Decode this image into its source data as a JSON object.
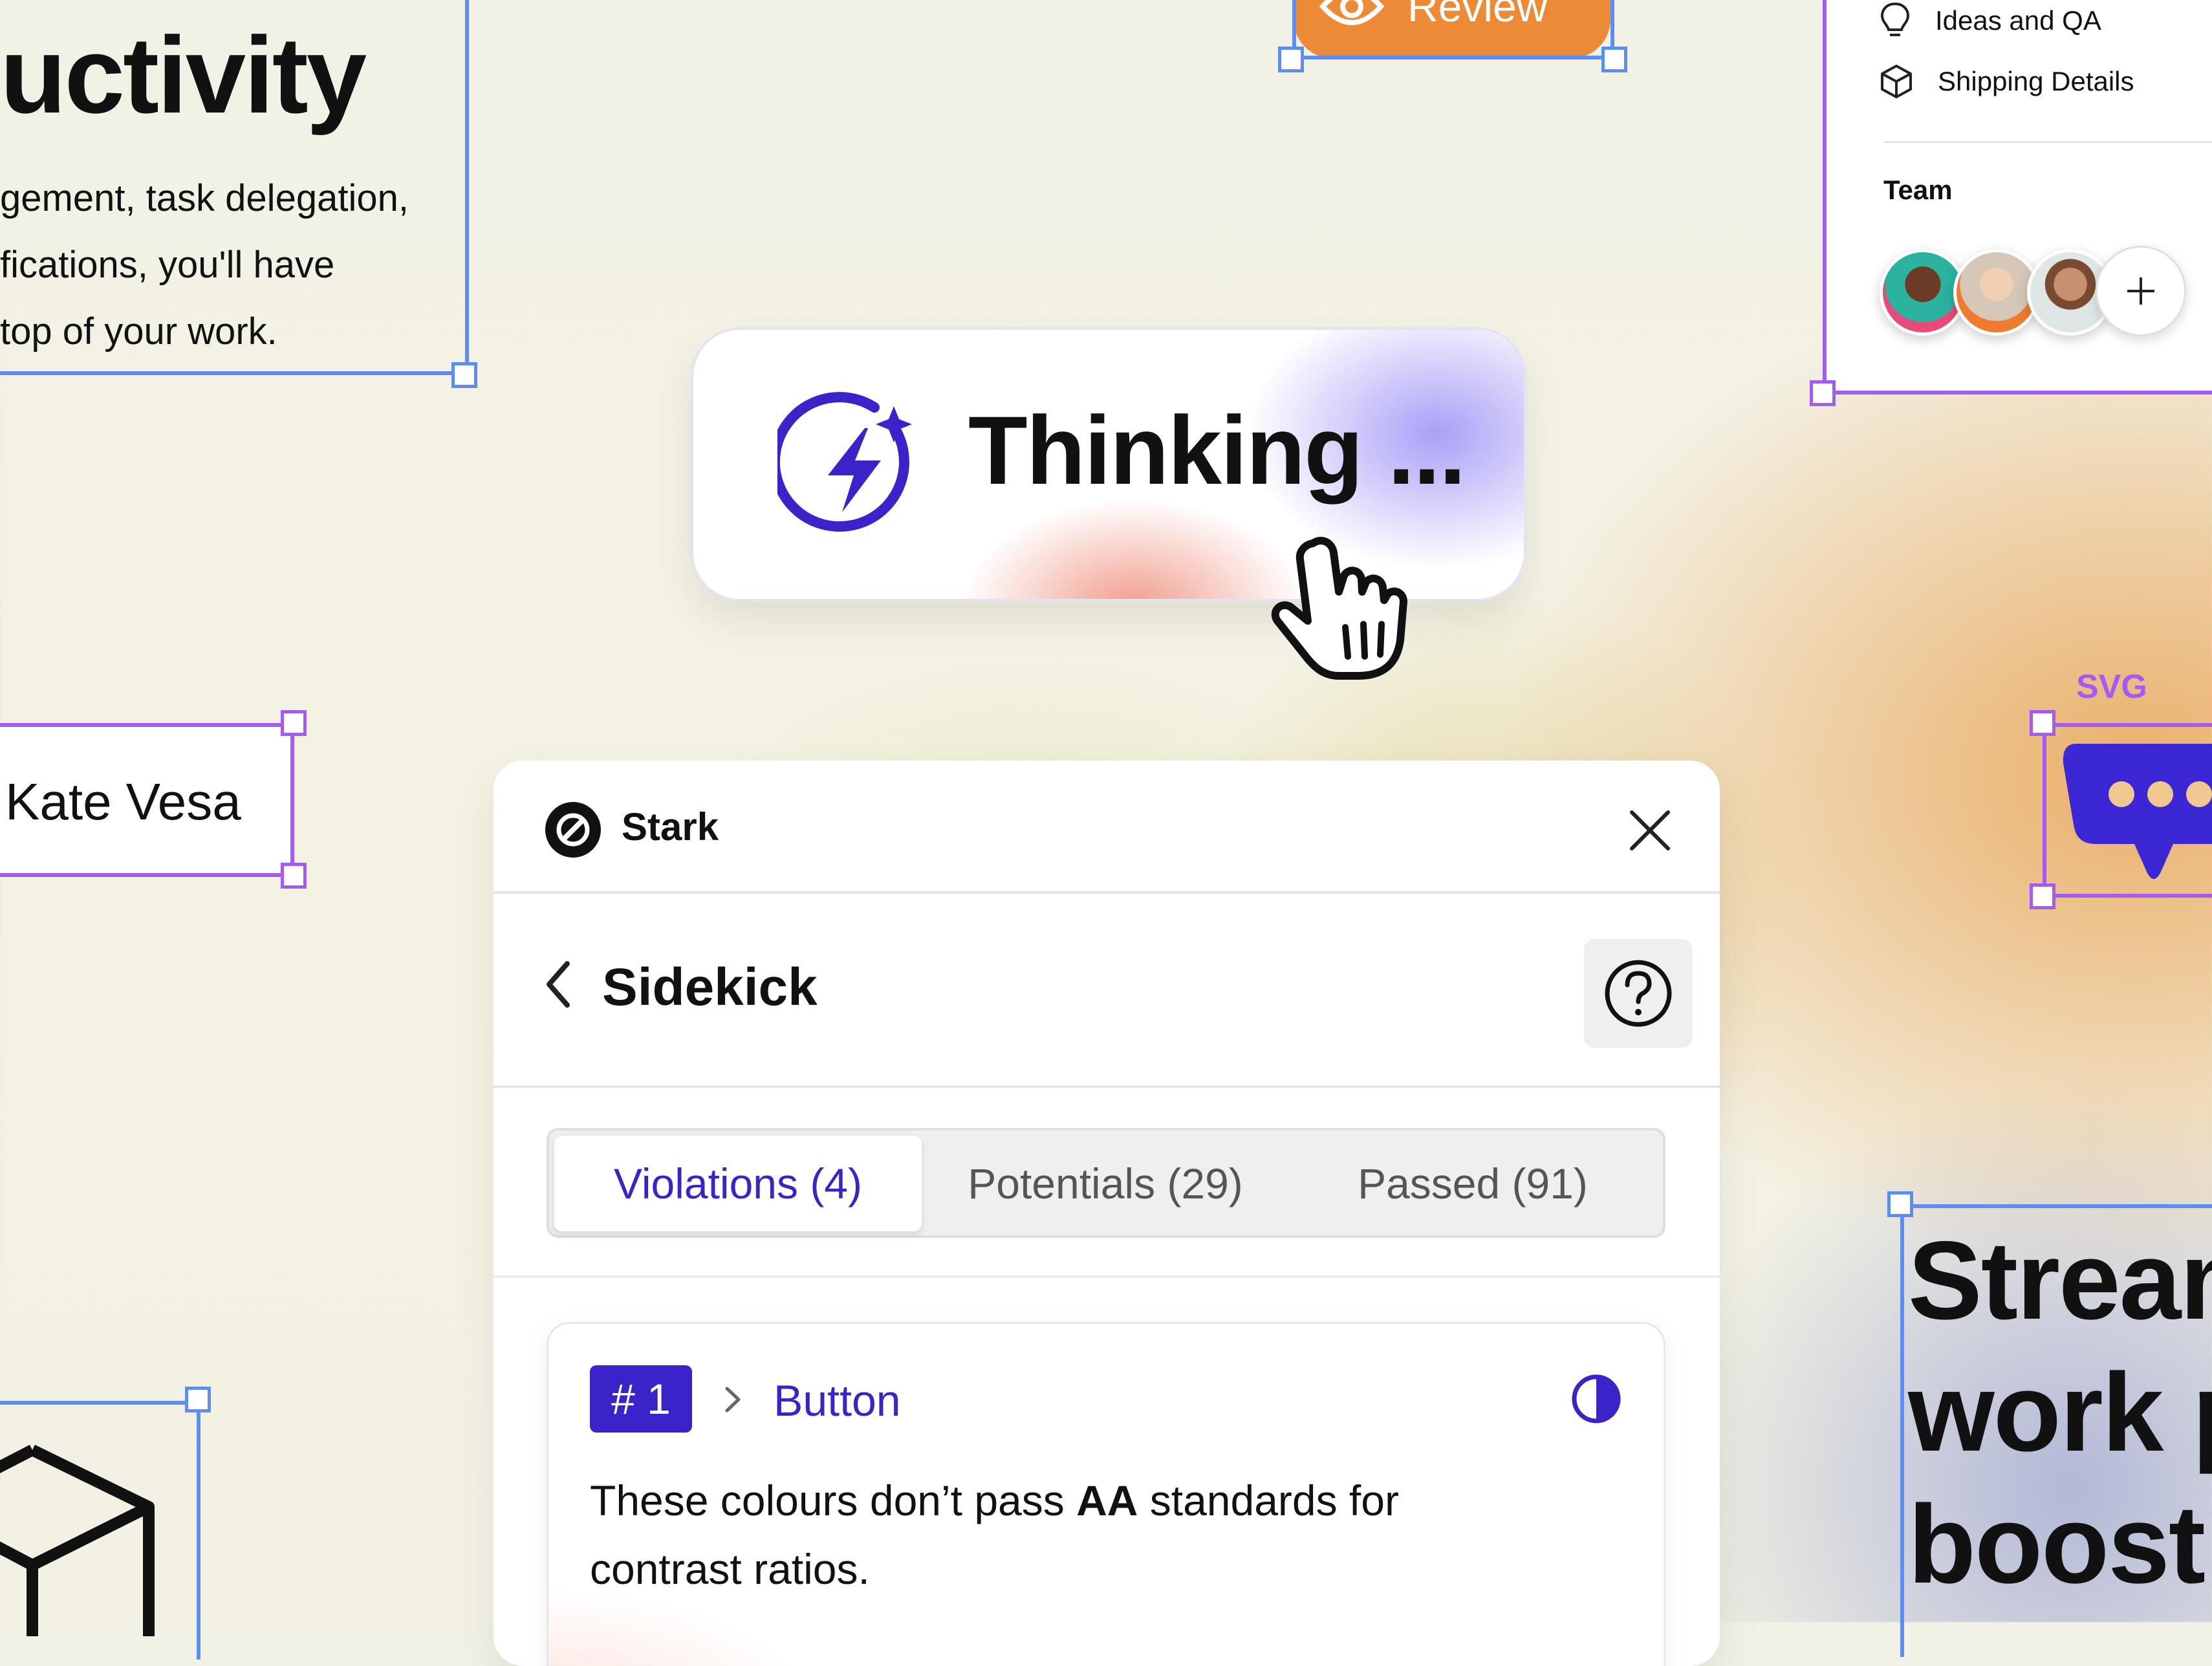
{
  "left_heading": {
    "title": "uctivity",
    "lines": [
      "gement, task delegation,",
      "fications, you'll have",
      "top of your work."
    ]
  },
  "review_button": {
    "label": "Review",
    "icon": "eye-icon"
  },
  "sidebar": {
    "items": [
      {
        "label": "Ideas and QA",
        "icon": "lightbulb-icon"
      },
      {
        "label": "Shipping Details",
        "icon": "box-icon"
      }
    ],
    "team_label": "Team"
  },
  "thinking_chip": {
    "label": "Thinking ...",
    "icon": "lightning-sparkle-icon"
  },
  "kate_label": "Kate Vesa",
  "svg_label": "SVG",
  "stream_heading": {
    "lines": [
      "Stream",
      "work p",
      "boost"
    ]
  },
  "panel": {
    "app_name": "Stark",
    "title": "Sidekick",
    "tabs": [
      {
        "label": "Violations (4)",
        "active": true
      },
      {
        "label": "Potentials (29)",
        "active": false
      },
      {
        "label": "Passed (91)",
        "active": false
      }
    ],
    "violation": {
      "number": "# 1",
      "element": "Button",
      "text_before": "These colours don’t pass ",
      "text_bold": "AA",
      "text_after": " standards for contrast ratios."
    }
  },
  "colors": {
    "accent_purple": "#3a23c8",
    "frame_blue": "#5b8ef0",
    "frame_purple": "#a35cf2",
    "review_orange": "#ec8a36"
  }
}
